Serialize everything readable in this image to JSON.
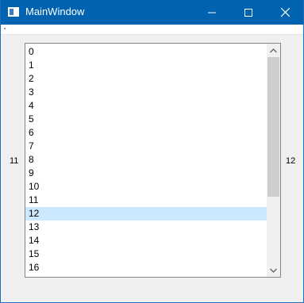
{
  "window": {
    "title": "MainWindow"
  },
  "labels": {
    "left": "11",
    "right": "12"
  },
  "list": {
    "items": [
      "0",
      "1",
      "2",
      "3",
      "4",
      "5",
      "6",
      "7",
      "8",
      "9",
      "10",
      "11",
      "12",
      "13",
      "14",
      "15",
      "16"
    ],
    "selected_item": "12"
  },
  "colors": {
    "titlebar": "#0063b1",
    "selection": "#cce8ff"
  },
  "icons": {
    "app": "app-window-icon",
    "minimize": "minimize-icon",
    "maximize": "maximize-icon",
    "close": "close-icon",
    "scroll_up": "chevron-up-icon",
    "scroll_down": "chevron-down-icon"
  }
}
